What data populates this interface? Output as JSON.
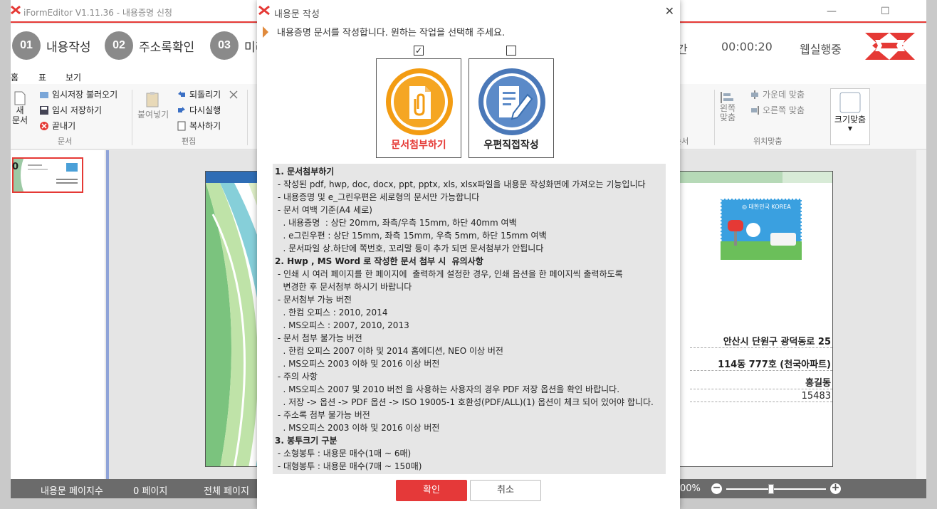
{
  "window": {
    "title": "iFormEditor V1.11.36 - 내용증명 신청",
    "minimize": "—",
    "maximize": "☐"
  },
  "steps": [
    {
      "num": "01",
      "label": "내용작성"
    },
    {
      "num": "02",
      "label": "주소록확인"
    },
    {
      "num": "03",
      "label": "미리"
    }
  ],
  "status_right": {
    "time_label_fragment": "간",
    "elapsed": "00:00:20",
    "mode": "웹실행중"
  },
  "menu": [
    "홈",
    "표",
    "보기"
  ],
  "ribbon": {
    "new_doc": "새\n문서",
    "load_temp": "임시저장 불러오기",
    "save_temp": "임시 저장하기",
    "close": "끝내기",
    "group_doc": "문서",
    "paste": "붙여넣기",
    "undo": "되돌리기",
    "redo": "다시실행",
    "copy": "복사하기",
    "group_edit": "편집",
    "left_align": "왼쪽\n맞춤",
    "center_align": "가운데 맞춤",
    "right_align": "오른쪽 맞춤",
    "group_position": "위치맞춤",
    "group_order_frag": "순서",
    "fit_size": "크기맞춤"
  },
  "thumbnail": {
    "page_num": "0"
  },
  "document": {
    "addr_line1": "안산시 단원구 광덕동로 25",
    "addr_line2": "114동 777호 (천국아파트)",
    "recipient": "홍길동",
    "zipcode": "15483"
  },
  "statusbar": {
    "page_count_label": "내용문 페이지수",
    "page_count": "0 페이지",
    "total_label": "전체 페이지",
    "zoom_fragment": "00%",
    "zoom_level": 0.45
  },
  "dialog": {
    "title": "내용문 작성",
    "close": "✕",
    "instruction": "내용증명 문서를 작성합니다. 원하는 작업을 선택해 주세요.",
    "options": [
      {
        "label": "문서첨부하기",
        "checked": true,
        "mark": "✓"
      },
      {
        "label": "우편직접작성",
        "checked": false,
        "mark": ""
      }
    ],
    "info_lines": [
      {
        "t": "1. 문서첨부하기",
        "b": true
      },
      {
        "t": " - 작성된 pdf, hwp, doc, docx, ppt, pptx, xls, xlsx파일을 내용문 작성화면에 가져오는 기능입니다"
      },
      {
        "t": " - 내용증명 및 e_그린우편은 세로형의 문서만 가능합니다"
      },
      {
        "t": " - 문서 여백 기준(A4 세로)"
      },
      {
        "t": "   . 내용증명  : 상단 20mm, 좌측/우측 15mm, 하단 40mm 여백"
      },
      {
        "t": "   . e그린우편 : 상단 15mm, 좌측 15mm, 우측 5mm, 하단 15mm 여백"
      },
      {
        "t": "   . 문서파일 상.하단에 쪽번호, 꼬리말 등이 추가 되면 문서첨부가 안됩니다"
      },
      {
        "t": "2. Hwp , MS Word 로 작성한 문서 첨부 시  유의사항",
        "b": true
      },
      {
        "t": " - 인쇄 시 여러 페이지를 한 페이지에  출력하게 설정한 경우, 인쇄 옵션을 한 페이지씩 출력하도록"
      },
      {
        "t": "   변경한 후 문서첨부 하시기 바랍니다"
      },
      {
        "t": " - 문서첨부 가능 버전"
      },
      {
        "t": "   . 한컴 오피스 : 2010, 2014"
      },
      {
        "t": "   . MS오피스 : 2007, 2010, 2013"
      },
      {
        "t": " - 문서 첨부 불가능 버전"
      },
      {
        "t": "   . 한컴 오피스 2007 이하 및 2014 홈에디션, NEO 이상 버전"
      },
      {
        "t": "   . MS오피스 2003 이하 및 2016 이상 버전"
      },
      {
        "t": " - 주의 사항"
      },
      {
        "t": "   . MS오피스 2007 및 2010 버전 을 사용하는 사용자의 경우 PDF 저장 옵션을 확인 바랍니다."
      },
      {
        "t": "   . 저장 -> 옵션 -> PDF 옵션 -> ISO 19005-1 호환성(PDF/ALL)(1) 옵션이 체크 되어 있어야 합니다."
      },
      {
        "t": " - 주소록 첨부 불가능 버전"
      },
      {
        "t": "   . MS오피스 2003 이하 및 2016 이상 버전"
      },
      {
        "t": "3. 봉투크기 구분",
        "b": true
      },
      {
        "t": " - 소형봉투 : 내용문 매수(1매 ~ 6매)"
      },
      {
        "t": " - 대형봉투 : 내용문 매수(7매 ~ 150매)"
      }
    ],
    "ok": "확인",
    "cancel": "취소"
  },
  "colors": {
    "accent_red": "#e53939",
    "orange": "#f39c12",
    "blue": "#4a78b8",
    "step_gray": "#8a8a8a"
  },
  "icons": [
    "app-logo-icon",
    "document-clip-icon",
    "write-pen-icon",
    "new-doc-icon",
    "undo-icon",
    "redo-icon",
    "copy-icon",
    "paste-icon",
    "close-icon"
  ]
}
